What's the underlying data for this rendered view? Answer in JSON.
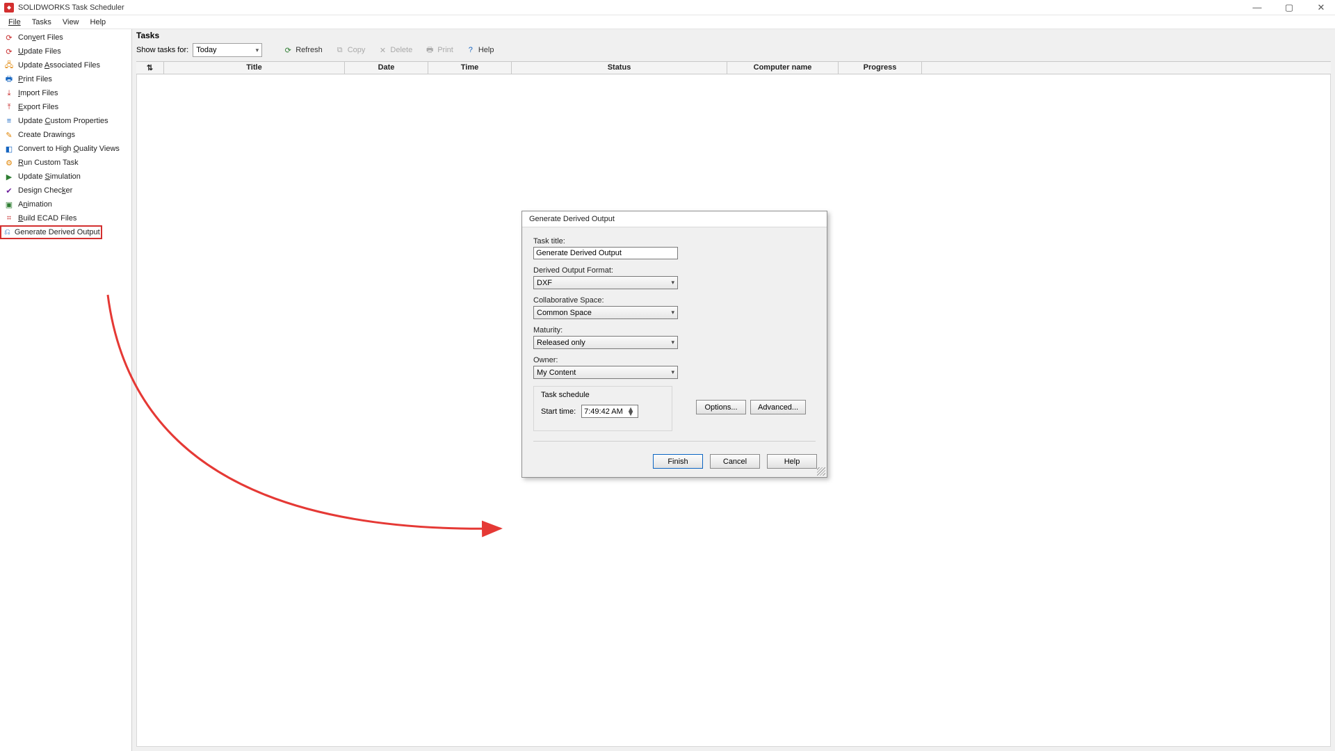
{
  "window": {
    "title": "SOLIDWORKS Task Scheduler"
  },
  "menubar": {
    "file": "File",
    "tasks": "Tasks",
    "view": "View",
    "help": "Help"
  },
  "sidebar": {
    "items": [
      {
        "icon": "convert-icon",
        "color": "ico-red",
        "label_pre": "Con",
        "label_u": "v",
        "label_post": "ert Files"
      },
      {
        "icon": "update-icon",
        "color": "ico-red",
        "label_pre": "",
        "label_u": "U",
        "label_post": "pdate Files"
      },
      {
        "icon": "assoc-icon",
        "color": "ico-orange",
        "label_pre": "Update ",
        "label_u": "A",
        "label_post": "ssociated Files"
      },
      {
        "icon": "print-icon",
        "color": "ico-blue",
        "label_pre": "",
        "label_u": "P",
        "label_post": "rint Files"
      },
      {
        "icon": "import-icon",
        "color": "ico-red",
        "label_pre": "",
        "label_u": "I",
        "label_post": "mport Files"
      },
      {
        "icon": "export-icon",
        "color": "ico-red",
        "label_pre": "",
        "label_u": "E",
        "label_post": "xport Files"
      },
      {
        "icon": "props-icon",
        "color": "ico-blue",
        "label_pre": "Update ",
        "label_u": "C",
        "label_post": "ustom Properties"
      },
      {
        "icon": "drawings-icon",
        "color": "ico-orange",
        "label_pre": "Create Drawin",
        "label_u": "g",
        "label_post": "s"
      },
      {
        "icon": "hq-icon",
        "color": "ico-blue",
        "label_pre": "Convert to High ",
        "label_u": "Q",
        "label_post": "uality Views"
      },
      {
        "icon": "runtask-icon",
        "color": "ico-orange",
        "label_pre": "",
        "label_u": "R",
        "label_post": "un Custom Task"
      },
      {
        "icon": "sim-icon",
        "color": "ico-green",
        "label_pre": "Update ",
        "label_u": "S",
        "label_post": "imulation"
      },
      {
        "icon": "design-icon",
        "color": "ico-purple",
        "label_pre": "Design Chec",
        "label_u": "k",
        "label_post": "er"
      },
      {
        "icon": "anim-icon",
        "color": "ico-green",
        "label_pre": "A",
        "label_u": "n",
        "label_post": "imation"
      },
      {
        "icon": "ecad-icon",
        "color": "ico-red",
        "label_pre": "",
        "label_u": "B",
        "label_post": "uild ECAD Files"
      },
      {
        "icon": "derived-icon",
        "color": "ico-blue",
        "label_pre": "Generate Derived Output",
        "label_u": "",
        "label_post": ""
      }
    ]
  },
  "content": {
    "heading": "Tasks",
    "filter_label": "Show tasks for:",
    "filter_value": "Today",
    "buttons": {
      "refresh": "Refresh",
      "copy": "Copy",
      "delete": "Delete",
      "print": "Print",
      "help": "Help"
    },
    "columns": {
      "sort": "",
      "title": "Title",
      "date": "Date",
      "time": "Time",
      "status": "Status",
      "computer": "Computer name",
      "progress": "Progress"
    }
  },
  "dialog": {
    "title": "Generate Derived Output",
    "task_title_label": "Task title:",
    "task_title_value": "Generate Derived Output",
    "format_label": "Derived Output Format:",
    "format_value": "DXF",
    "collab_label": "Collaborative Space:",
    "collab_value": "Common Space",
    "maturity_label": "Maturity:",
    "maturity_value": "Released only",
    "owner_label": "Owner:",
    "owner_value": "My Content",
    "schedule_label": "Task schedule",
    "start_time_label": "Start time:",
    "start_time_value": "7:49:42 AM",
    "options_btn": "Options...",
    "advanced_btn": "Advanced...",
    "finish_btn": "Finish",
    "cancel_btn": "Cancel",
    "help_btn": "Help"
  }
}
